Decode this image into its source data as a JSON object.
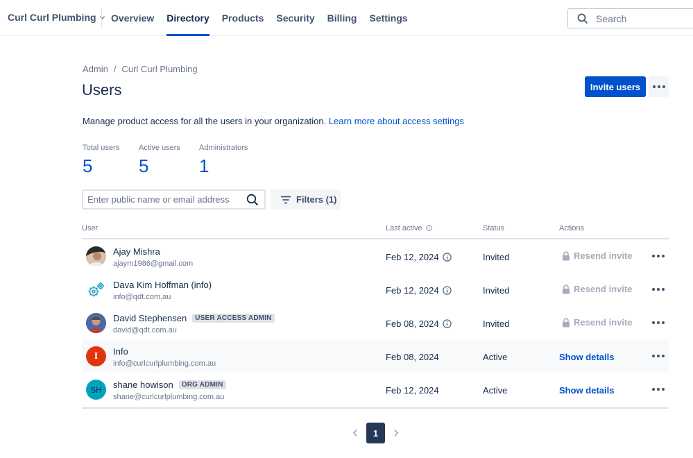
{
  "org": {
    "name": "Curl Curl Plumbing"
  },
  "nav": {
    "tabs": [
      {
        "label": "Overview",
        "active": false
      },
      {
        "label": "Directory",
        "active": true
      },
      {
        "label": "Products",
        "active": false
      },
      {
        "label": "Security",
        "active": false
      },
      {
        "label": "Billing",
        "active": false
      },
      {
        "label": "Settings",
        "active": false
      }
    ],
    "search_placeholder": "Search"
  },
  "breadcrumb": {
    "items": [
      "Admin",
      "Curl Curl Plumbing"
    ],
    "separator": "/"
  },
  "page": {
    "title": "Users",
    "invite_label": "Invite users",
    "description": "Manage product access for all the users in your organization.",
    "learn_more": "Learn more about access settings"
  },
  "stats": [
    {
      "label": "Total users",
      "value": "5"
    },
    {
      "label": "Active users",
      "value": "5"
    },
    {
      "label": "Administrators",
      "value": "1"
    }
  ],
  "user_search": {
    "placeholder": "Enter public name or email address"
  },
  "filter": {
    "label": "Filters (1)"
  },
  "table": {
    "headers": {
      "user": "User",
      "last_active": "Last active",
      "status": "Status",
      "actions": "Actions"
    },
    "rows": [
      {
        "name": "Ajay Mishra",
        "email": "ajaym1986@gmail.com",
        "badge": "",
        "last_active": "Feb 12, 2024",
        "status": "Invited",
        "action": "Resend invite",
        "action_enabled": false,
        "avatar": {
          "type": "photo",
          "icon": "person-photo-icon"
        }
      },
      {
        "name": "Dava Kim Hoffman (info)",
        "email": "info@qdt.com.au",
        "badge": "",
        "last_active": "Feb 12, 2024",
        "status": "Invited",
        "action": "Resend invite",
        "action_enabled": false,
        "avatar": {
          "type": "gears",
          "icon": "gears-icon"
        }
      },
      {
        "name": "David Stephensen",
        "email": "david@qdt.com.au",
        "badge": "USER ACCESS ADMIN",
        "last_active": "Feb 08, 2024",
        "status": "Invited",
        "action": "Resend invite",
        "action_enabled": false,
        "avatar": {
          "type": "photo",
          "icon": "person-photo-icon"
        }
      },
      {
        "name": "Info",
        "email": "info@curlcurlplumbing.com.au",
        "badge": "",
        "last_active": "Feb 08, 2024",
        "status": "Active",
        "action": "Show details",
        "action_enabled": true,
        "avatar": {
          "type": "initials",
          "initials": "I",
          "color": "#de350b"
        }
      },
      {
        "name": "shane howison",
        "email": "shane@curlcurlplumbing.com.au",
        "badge": "ORG ADMIN",
        "last_active": "Feb 12, 2024",
        "status": "Active",
        "action": "Show details",
        "action_enabled": true,
        "avatar": {
          "type": "initials",
          "initials": "SH",
          "color": "#00a3bf"
        }
      }
    ]
  },
  "pagination": {
    "current_page": "1"
  },
  "colors": {
    "primary": "#0052cc",
    "text": "#172b4d",
    "muted": "#6b778c",
    "pager_active": "#253858"
  }
}
